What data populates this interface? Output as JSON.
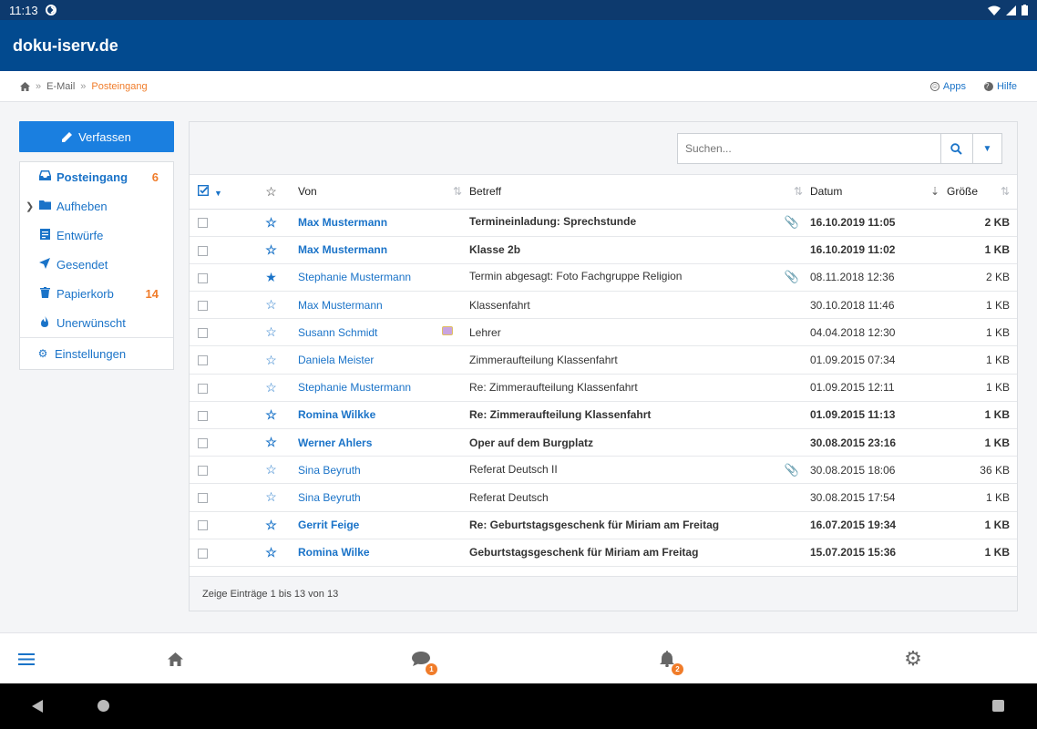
{
  "status": {
    "time": "11:13"
  },
  "app": {
    "title": "doku-iserv.de"
  },
  "breadcrumb": {
    "items": [
      "E-Mail",
      "Posteingang"
    ],
    "apps_label": "Apps",
    "help_label": "Hilfe"
  },
  "sidebar": {
    "compose_label": "Verfassen",
    "folders": [
      {
        "label": "Posteingang",
        "count": "6",
        "icon": "inbox-icon"
      },
      {
        "label": "Aufheben",
        "count": "",
        "icon": "folder-icon"
      },
      {
        "label": "Entwürfe",
        "count": "",
        "icon": "drafts-icon"
      },
      {
        "label": "Gesendet",
        "count": "",
        "icon": "send-icon"
      },
      {
        "label": "Papierkorb",
        "count": "14",
        "icon": "trash-icon"
      },
      {
        "label": "Unerwünscht",
        "count": "",
        "icon": "fire-icon"
      }
    ],
    "settings_label": "Einstellungen"
  },
  "search": {
    "placeholder": "Suchen..."
  },
  "table": {
    "headers": {
      "from": "Von",
      "subject": "Betreff",
      "date": "Datum",
      "size": "Größe"
    },
    "rows": [
      {
        "from": "Max Mustermann",
        "subject": "Termineinladung: Sprechstunde",
        "date": "16.10.2019 11:05",
        "size": "2 KB",
        "unread": true,
        "starred": false,
        "attachment": true,
        "vcard": false
      },
      {
        "from": "Max Mustermann",
        "subject": "Klasse 2b",
        "date": "16.10.2019 11:02",
        "size": "1 KB",
        "unread": true,
        "starred": false,
        "attachment": false,
        "vcard": false
      },
      {
        "from": "Stephanie Mustermann",
        "subject": "Termin abgesagt: Foto Fachgruppe Religion",
        "date": "08.11.2018 12:36",
        "size": "2 KB",
        "unread": false,
        "starred": true,
        "attachment": true,
        "vcard": false
      },
      {
        "from": "Max Mustermann",
        "subject": "Klassenfahrt",
        "date": "30.10.2018 11:46",
        "size": "1 KB",
        "unread": false,
        "starred": false,
        "attachment": false,
        "vcard": false
      },
      {
        "from": "Susann Schmidt",
        "subject": "Lehrer",
        "date": "04.04.2018 12:30",
        "size": "1 KB",
        "unread": false,
        "starred": false,
        "attachment": false,
        "vcard": true
      },
      {
        "from": "Daniela Meister",
        "subject": "Zimmeraufteilung Klassenfahrt",
        "date": "01.09.2015 07:34",
        "size": "1 KB",
        "unread": false,
        "starred": false,
        "attachment": false,
        "vcard": false
      },
      {
        "from": "Stephanie Mustermann",
        "subject": "Re: Zimmeraufteilung Klassenfahrt",
        "date": "01.09.2015 12:11",
        "size": "1 KB",
        "unread": false,
        "starred": false,
        "attachment": false,
        "vcard": false
      },
      {
        "from": "Romina Wilkke",
        "subject": "Re: Zimmeraufteilung Klassenfahrt",
        "date": "01.09.2015 11:13",
        "size": "1 KB",
        "unread": true,
        "starred": false,
        "attachment": false,
        "vcard": false
      },
      {
        "from": "Werner Ahlers",
        "subject": "Oper auf dem Burgplatz",
        "date": "30.08.2015 23:16",
        "size": "1 KB",
        "unread": true,
        "starred": false,
        "attachment": false,
        "vcard": false
      },
      {
        "from": "Sina Beyruth",
        "subject": "Referat Deutsch II",
        "date": "30.08.2015 18:06",
        "size": "36 KB",
        "unread": false,
        "starred": false,
        "attachment": true,
        "vcard": false
      },
      {
        "from": "Sina Beyruth",
        "subject": "Referat Deutsch",
        "date": "30.08.2015 17:54",
        "size": "1 KB",
        "unread": false,
        "starred": false,
        "attachment": false,
        "vcard": false
      },
      {
        "from": "Gerrit Feige",
        "subject": "Re: Geburtstagsgeschenk für Miriam am Freitag",
        "date": "16.07.2015 19:34",
        "size": "1 KB",
        "unread": true,
        "starred": false,
        "attachment": false,
        "vcard": false
      },
      {
        "from": "Romina Wilke",
        "subject": "Geburtstagsgeschenk für Miriam am Freitag",
        "date": "15.07.2015 15:36",
        "size": "1 KB",
        "unread": true,
        "starred": false,
        "attachment": false,
        "vcard": false
      }
    ],
    "footer": "Zeige Einträge 1 bis 13 von 13"
  },
  "bottom_nav": {
    "messages_badge": "1",
    "notifications_badge": "2"
  },
  "colors": {
    "accent": "#1a7fe0",
    "header": "#024a8f",
    "highlight": "#f07c2a"
  }
}
